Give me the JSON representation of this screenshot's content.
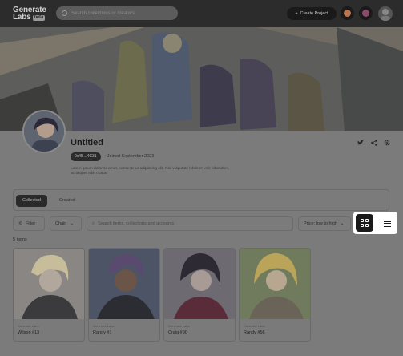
{
  "header": {
    "logo_line1": "Generate",
    "logo_line2": "Labs",
    "logo_badge": "beta",
    "search_placeholder": "Search collections or creators",
    "create_button": "Create Project"
  },
  "profile": {
    "name": "Untitled",
    "wallet": "0x4B...4C31",
    "joined": "Joined September 2023",
    "bio": "Lorem ipsum dolor sit amet, consectetur adipiscing elit. Nisi vulputate lobtis et velit bibendum, ac aliquet nibh mattis."
  },
  "tabs": [
    {
      "label": "Collected",
      "active": true
    },
    {
      "label": "Created",
      "active": false
    }
  ],
  "filters": {
    "filter_label": "Filter",
    "chain_label": "Chain",
    "search_placeholder": "Search items, collections and accounts",
    "sort_label": "Price: low to high"
  },
  "item_count": "5 items",
  "cards": [
    {
      "sub": "Generate Labs",
      "title": "Wilson #13",
      "color": "#d8cfc7"
    },
    {
      "sub": "Generate Labs",
      "title": "Randy #1",
      "color": "#3a4a6e"
    },
    {
      "sub": "Generate Labs",
      "title": "Craig #90",
      "color": "#c9b8d9"
    },
    {
      "sub": "Generate Labs",
      "title": "Randy #56",
      "color": "#b9c19a"
    }
  ],
  "colors": {
    "overlay": "#7b7b7b",
    "header_bg": "#2c2c2c",
    "highlight": "#ffffff",
    "active_view": "#1a1a1a"
  }
}
